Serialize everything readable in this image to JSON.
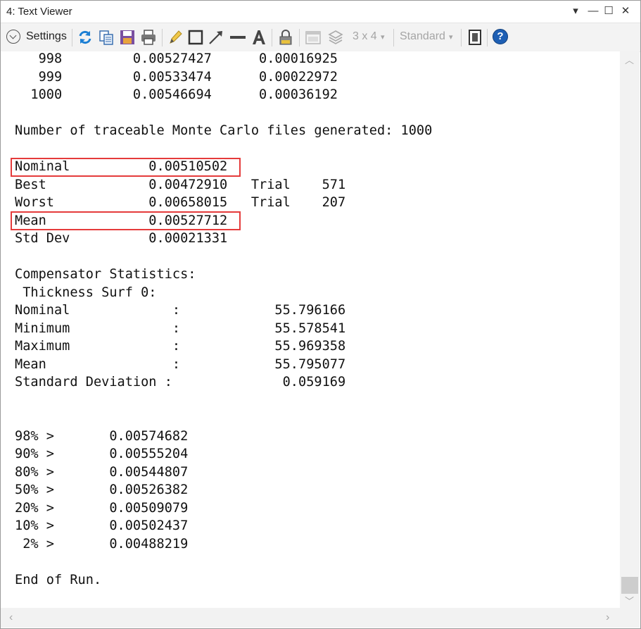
{
  "window": {
    "title": "4: Text Viewer"
  },
  "titlebar_controls": {
    "dropdown": "▾",
    "minimize": "—",
    "maximize": "☐",
    "close": "✕"
  },
  "toolbar": {
    "settings_label": "Settings",
    "layout_label": "3 x 4",
    "layout_arrow": "▾",
    "style_label": "Standard",
    "style_arrow": "▾",
    "help_label": "?"
  },
  "text_content": "   998         0.00527427      0.00016925\n   999         0.00533474      0.00022972\n  1000         0.00546694      0.00036192\n\nNumber of traceable Monte Carlo files generated: 1000\n\nNominal          0.00510502\nBest             0.00472910   Trial    571\nWorst            0.00658015   Trial    207\nMean             0.00527712\nStd Dev          0.00021331\n\nCompensator Statistics:\n Thickness Surf 0:\nNominal             :            55.796166\nMinimum             :            55.578541\nMaximum             :            55.969358\nMean                :            55.795077\nStandard Deviation :              0.059169\n\n\n98% >       0.00574682\n90% >       0.00555204\n80% >       0.00544807\n50% >       0.00526382\n20% >       0.00509079\n10% >       0.00502437\n 2% >       0.00488219\n\nEnd of Run.",
  "scroll_arrows": {
    "up": "︿",
    "down": "﹀",
    "left": "‹",
    "right": "›"
  },
  "colors": {
    "highlight": "#e53b3b",
    "help_blue": "#1e5fb4",
    "refresh_blue": "#1c7fd4"
  }
}
